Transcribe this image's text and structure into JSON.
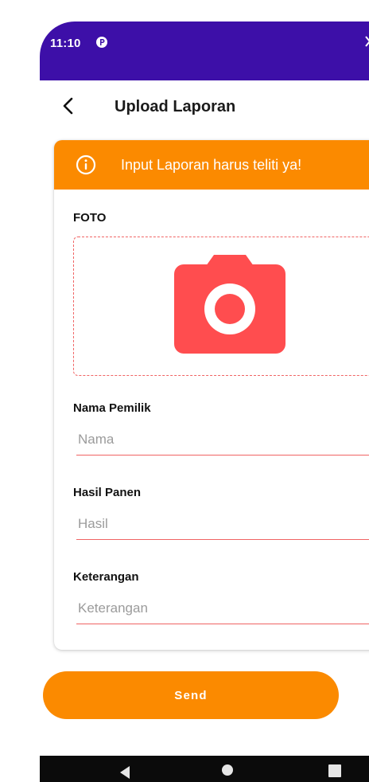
{
  "status_bar": {
    "time": "11:10"
  },
  "app_bar": {
    "title": "Upload Laporan",
    "back_icon": "arrow-back-icon"
  },
  "banner": {
    "text": "Input Laporan harus teliti ya!",
    "icon": "info-icon",
    "color": "#fb8a00"
  },
  "form": {
    "photo_label": "FOTO",
    "photo_icon": "camera-icon",
    "fields": [
      {
        "label": "Nama Pemilik",
        "placeholder": "Nama",
        "value": ""
      },
      {
        "label": "Hasil Panen",
        "placeholder": "Hasil",
        "value": ""
      },
      {
        "label": "Keterangan",
        "placeholder": "Keterangan",
        "value": ""
      }
    ]
  },
  "send_button": {
    "label": "Send"
  },
  "colors": {
    "status_bar": "#3d0fa8",
    "accent": "#fb8a00",
    "underline": "#f06464",
    "camera": "#ff4d4f"
  },
  "nav_bar": {
    "icons": [
      "nav-back-icon",
      "nav-home-icon",
      "nav-recents-icon"
    ]
  }
}
